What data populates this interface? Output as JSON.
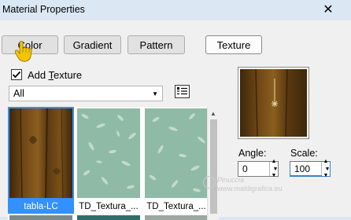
{
  "window": {
    "title": "Material Properties",
    "close_glyph": "✕"
  },
  "tabs": [
    {
      "label": "Color",
      "active": false
    },
    {
      "label": "Gradient",
      "active": false
    },
    {
      "label": "Pattern",
      "active": false
    },
    {
      "label": "Texture",
      "active": true
    }
  ],
  "texture": {
    "checkbox_label_pre": "Add ",
    "checkbox_label_underlined": "T",
    "checkbox_label_post": "exture",
    "checked": true,
    "category": "All",
    "items": [
      {
        "name": "tabla-LC",
        "selected": true,
        "kind": "wood"
      },
      {
        "name": "TD_Textura_...",
        "selected": false,
        "kind": "leaves"
      },
      {
        "name": "TD_Textura_...",
        "selected": false,
        "kind": "leaves"
      }
    ]
  },
  "angle": {
    "label": "Angle:",
    "value": "0"
  },
  "scale": {
    "label": "Scale:",
    "value": "100"
  },
  "watermark": {
    "line1": "Pinuccia",
    "line2": "www.maldigrafica.eu"
  },
  "colors": {
    "selection": "#3390ff",
    "wood": "#5a3a12",
    "leaves": "#8fbaa6",
    "pointer_hand": "#f4c400"
  },
  "icons": {
    "close": "close-icon",
    "checkbox": "checkmark-icon",
    "dropdown": "chevron-down-icon",
    "browse": "browse-textures-icon",
    "scroll_up": "scroll-up-arrow-icon",
    "pointer": "pointing-hand-cursor-icon"
  }
}
